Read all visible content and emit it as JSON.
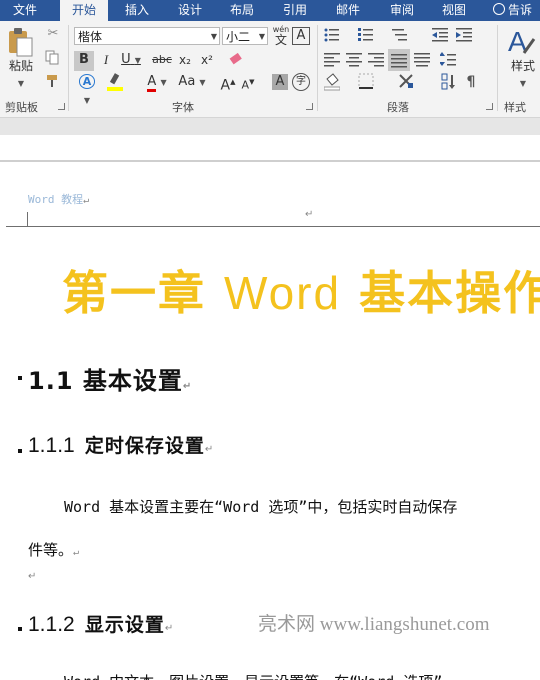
{
  "tabs": [
    {
      "label": "文件",
      "active": false
    },
    {
      "label": "开始",
      "active": true
    },
    {
      "label": "插入",
      "active": false
    },
    {
      "label": "设计",
      "active": false
    },
    {
      "label": "布局",
      "active": false
    },
    {
      "label": "引用",
      "active": false
    },
    {
      "label": "邮件",
      "active": false
    },
    {
      "label": "审阅",
      "active": false
    },
    {
      "label": "视图",
      "active": false
    }
  ],
  "tell_me": "告诉我",
  "ribbon": {
    "clipboard": {
      "paste_label": "粘贴",
      "group_label": "剪贴板"
    },
    "font": {
      "font_name": "楷体",
      "font_size": "小二",
      "wen": "wén",
      "wen_char": "文",
      "group_label": "字体",
      "buttons": {
        "bold": "B",
        "italic": "I",
        "underline": "U",
        "strike": "abc",
        "sub": "x₂",
        "sup": "x²",
        "font_color": "A",
        "case": "Aa",
        "grow": "A",
        "shrink": "A",
        "shade": "A",
        "enclose": "字"
      }
    },
    "paragraph": {
      "group_label": "段落"
    },
    "styles": {
      "label": "样式",
      "group_label": "样式"
    }
  },
  "colors": {
    "accent": "#2b579a",
    "chapter_gold": "#f4c21e",
    "highlight": "#ffff00",
    "font_red": "#e00000"
  },
  "document": {
    "header_text": "Word 教程",
    "chapter_title_cn1": "第一章 ",
    "chapter_title_word": "Word",
    "chapter_title_cn2": "  基本操作",
    "h2": "1.1  基本设置",
    "sections": [
      {
        "number": "1.1.1",
        "title": "定时保存设置"
      },
      {
        "number": "1.1.2",
        "title": "显示设置"
      }
    ],
    "para1_line1": "Word 基本设置主要在“Word 选项”中，包括实时自动保存",
    "para1_line2": "件等。",
    "para2_partial": "Word 中文本、图片设置、显示设置等，在“Word 选项”"
  },
  "watermark": "亮术网 www.liangshunet.com"
}
